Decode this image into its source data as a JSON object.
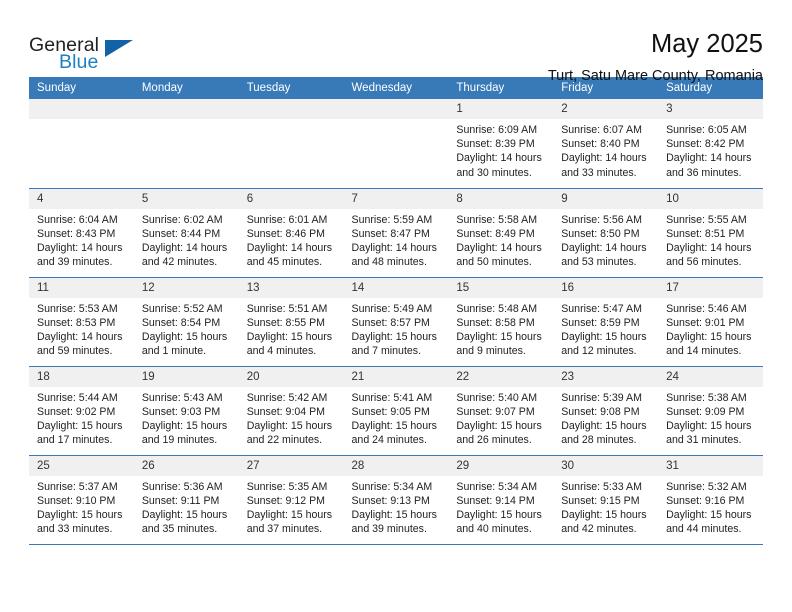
{
  "logo": {
    "word_top": "General",
    "word_bottom": "Blue",
    "triangle_color": "#1362a8",
    "blue_color": "#1d7fc4"
  },
  "header": {
    "title": "May 2025",
    "subtitle": "Turt, Satu Mare County, Romania"
  },
  "theme": {
    "header_bg": "#3879b8",
    "daynum_bg": "#f0f0f0",
    "grid_line": "#3879b8"
  },
  "calendar": {
    "weekday_headers": [
      "Sunday",
      "Monday",
      "Tuesday",
      "Wednesday",
      "Thursday",
      "Friday",
      "Saturday"
    ],
    "weeks": [
      [
        {
          "day": "",
          "empty": true
        },
        {
          "day": "",
          "empty": true
        },
        {
          "day": "",
          "empty": true
        },
        {
          "day": "",
          "empty": true
        },
        {
          "day": "1",
          "sunrise": "Sunrise: 6:09 AM",
          "sunset": "Sunset: 8:39 PM",
          "daylight": "Daylight: 14 hours and 30 minutes."
        },
        {
          "day": "2",
          "sunrise": "Sunrise: 6:07 AM",
          "sunset": "Sunset: 8:40 PM",
          "daylight": "Daylight: 14 hours and 33 minutes."
        },
        {
          "day": "3",
          "sunrise": "Sunrise: 6:05 AM",
          "sunset": "Sunset: 8:42 PM",
          "daylight": "Daylight: 14 hours and 36 minutes."
        }
      ],
      [
        {
          "day": "4",
          "sunrise": "Sunrise: 6:04 AM",
          "sunset": "Sunset: 8:43 PM",
          "daylight": "Daylight: 14 hours and 39 minutes."
        },
        {
          "day": "5",
          "sunrise": "Sunrise: 6:02 AM",
          "sunset": "Sunset: 8:44 PM",
          "daylight": "Daylight: 14 hours and 42 minutes."
        },
        {
          "day": "6",
          "sunrise": "Sunrise: 6:01 AM",
          "sunset": "Sunset: 8:46 PM",
          "daylight": "Daylight: 14 hours and 45 minutes."
        },
        {
          "day": "7",
          "sunrise": "Sunrise: 5:59 AM",
          "sunset": "Sunset: 8:47 PM",
          "daylight": "Daylight: 14 hours and 48 minutes."
        },
        {
          "day": "8",
          "sunrise": "Sunrise: 5:58 AM",
          "sunset": "Sunset: 8:49 PM",
          "daylight": "Daylight: 14 hours and 50 minutes."
        },
        {
          "day": "9",
          "sunrise": "Sunrise: 5:56 AM",
          "sunset": "Sunset: 8:50 PM",
          "daylight": "Daylight: 14 hours and 53 minutes."
        },
        {
          "day": "10",
          "sunrise": "Sunrise: 5:55 AM",
          "sunset": "Sunset: 8:51 PM",
          "daylight": "Daylight: 14 hours and 56 minutes."
        }
      ],
      [
        {
          "day": "11",
          "sunrise": "Sunrise: 5:53 AM",
          "sunset": "Sunset: 8:53 PM",
          "daylight": "Daylight: 14 hours and 59 minutes."
        },
        {
          "day": "12",
          "sunrise": "Sunrise: 5:52 AM",
          "sunset": "Sunset: 8:54 PM",
          "daylight": "Daylight: 15 hours and 1 minute."
        },
        {
          "day": "13",
          "sunrise": "Sunrise: 5:51 AM",
          "sunset": "Sunset: 8:55 PM",
          "daylight": "Daylight: 15 hours and 4 minutes."
        },
        {
          "day": "14",
          "sunrise": "Sunrise: 5:49 AM",
          "sunset": "Sunset: 8:57 PM",
          "daylight": "Daylight: 15 hours and 7 minutes."
        },
        {
          "day": "15",
          "sunrise": "Sunrise: 5:48 AM",
          "sunset": "Sunset: 8:58 PM",
          "daylight": "Daylight: 15 hours and 9 minutes."
        },
        {
          "day": "16",
          "sunrise": "Sunrise: 5:47 AM",
          "sunset": "Sunset: 8:59 PM",
          "daylight": "Daylight: 15 hours and 12 minutes."
        },
        {
          "day": "17",
          "sunrise": "Sunrise: 5:46 AM",
          "sunset": "Sunset: 9:01 PM",
          "daylight": "Daylight: 15 hours and 14 minutes."
        }
      ],
      [
        {
          "day": "18",
          "sunrise": "Sunrise: 5:44 AM",
          "sunset": "Sunset: 9:02 PM",
          "daylight": "Daylight: 15 hours and 17 minutes."
        },
        {
          "day": "19",
          "sunrise": "Sunrise: 5:43 AM",
          "sunset": "Sunset: 9:03 PM",
          "daylight": "Daylight: 15 hours and 19 minutes."
        },
        {
          "day": "20",
          "sunrise": "Sunrise: 5:42 AM",
          "sunset": "Sunset: 9:04 PM",
          "daylight": "Daylight: 15 hours and 22 minutes."
        },
        {
          "day": "21",
          "sunrise": "Sunrise: 5:41 AM",
          "sunset": "Sunset: 9:05 PM",
          "daylight": "Daylight: 15 hours and 24 minutes."
        },
        {
          "day": "22",
          "sunrise": "Sunrise: 5:40 AM",
          "sunset": "Sunset: 9:07 PM",
          "daylight": "Daylight: 15 hours and 26 minutes."
        },
        {
          "day": "23",
          "sunrise": "Sunrise: 5:39 AM",
          "sunset": "Sunset: 9:08 PM",
          "daylight": "Daylight: 15 hours and 28 minutes."
        },
        {
          "day": "24",
          "sunrise": "Sunrise: 5:38 AM",
          "sunset": "Sunset: 9:09 PM",
          "daylight": "Daylight: 15 hours and 31 minutes."
        }
      ],
      [
        {
          "day": "25",
          "sunrise": "Sunrise: 5:37 AM",
          "sunset": "Sunset: 9:10 PM",
          "daylight": "Daylight: 15 hours and 33 minutes."
        },
        {
          "day": "26",
          "sunrise": "Sunrise: 5:36 AM",
          "sunset": "Sunset: 9:11 PM",
          "daylight": "Daylight: 15 hours and 35 minutes."
        },
        {
          "day": "27",
          "sunrise": "Sunrise: 5:35 AM",
          "sunset": "Sunset: 9:12 PM",
          "daylight": "Daylight: 15 hours and 37 minutes."
        },
        {
          "day": "28",
          "sunrise": "Sunrise: 5:34 AM",
          "sunset": "Sunset: 9:13 PM",
          "daylight": "Daylight: 15 hours and 39 minutes."
        },
        {
          "day": "29",
          "sunrise": "Sunrise: 5:34 AM",
          "sunset": "Sunset: 9:14 PM",
          "daylight": "Daylight: 15 hours and 40 minutes."
        },
        {
          "day": "30",
          "sunrise": "Sunrise: 5:33 AM",
          "sunset": "Sunset: 9:15 PM",
          "daylight": "Daylight: 15 hours and 42 minutes."
        },
        {
          "day": "31",
          "sunrise": "Sunrise: 5:32 AM",
          "sunset": "Sunset: 9:16 PM",
          "daylight": "Daylight: 15 hours and 44 minutes."
        }
      ]
    ]
  }
}
